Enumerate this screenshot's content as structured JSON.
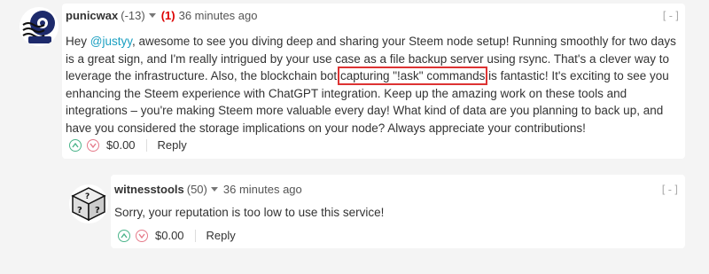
{
  "comment1": {
    "author": "punicwax",
    "reputation": "(-13)",
    "flag_count": "(1)",
    "time": "36 minutes ago",
    "collapse": "[-]",
    "body": {
      "p1": "Hey ",
      "mention": "@justyy",
      "p2": ", awesome to see you diving deep and sharing your Steem node setup! Running smoothly for two days is a great sign, and I'm really intrigued by your use case as a file backup server using rsync. That's a clever way to leverage the infrastructure. Also, the blockchain bot ",
      "highlight": "capturing \"!ask\" commands",
      "p3": " is fantastic! It's exciting to see you enhancing the Steem experience with ChatGPT integration. Keep up the amazing work on these tools and integrations – you're making Steem more valuable every day! What kind of data are you planning to back up, and have you considered the storage implications on your node? Always appreciate your contributions!"
    },
    "payout": "$0.00",
    "reply": "Reply"
  },
  "comment2": {
    "author": "witnesstools",
    "reputation": "(50)",
    "time": "36 minutes ago",
    "collapse": "[-]",
    "body": "Sorry, your reputation is too low to use this service!",
    "payout": "$0.00",
    "reply": "Reply"
  },
  "icons": {
    "upvote": "upvote-icon",
    "downvote": "downvote-icon",
    "caret": "chevron-down-icon"
  },
  "colors": {
    "mention": "#1a9fc1",
    "flag": "#dd0000",
    "upvote": "#4bb48a",
    "downvote": "#e57b8a",
    "highlight_box": "#dd3333"
  }
}
